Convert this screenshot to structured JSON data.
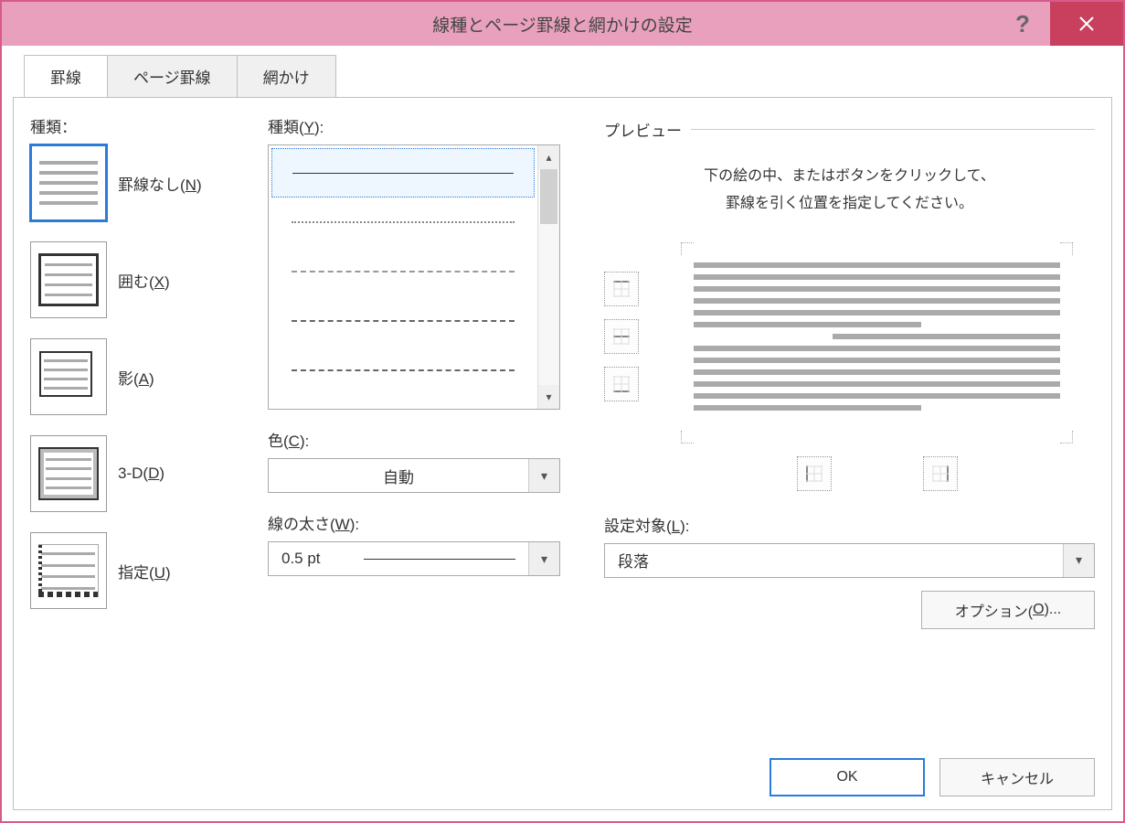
{
  "title": "線種とページ罫線と網かけの設定",
  "tabs": {
    "borders": "罫線",
    "page_borders": "ページ罫線",
    "shading": "網かけ"
  },
  "labels": {
    "setting": "種類：",
    "style": "種類(",
    "style_u": "Y",
    "style_suffix": "):",
    "color": "色(",
    "color_u": "C",
    "color_suffix": "):",
    "width": "線の太さ(",
    "width_u": "W",
    "width_suffix": "):",
    "preview": "プレビュー",
    "apply_to": "設定対象(",
    "apply_to_u": "L",
    "apply_to_suffix": "):"
  },
  "settings": {
    "none": "罫線なし(",
    "none_u": "N",
    "none_suffix": ")",
    "box": "囲む(",
    "box_u": "X",
    "box_suffix": ")",
    "shadow": "影(",
    "shadow_u": "A",
    "shadow_suffix": ")",
    "three_d": "3-D(",
    "three_d_u": "D",
    "three_d_suffix": ")",
    "custom": "指定(",
    "custom_u": "U",
    "custom_suffix": ")"
  },
  "values": {
    "color": "自動",
    "width": "0.5 pt",
    "apply_to": "段落"
  },
  "preview": {
    "line1": "下の絵の中、またはボタンをクリックして、",
    "line2": "罫線を引く位置を指定してください。"
  },
  "buttons": {
    "options": "オプション(",
    "options_u": "O",
    "options_suffix": ")...",
    "ok": "OK",
    "cancel": "キャンセル"
  }
}
